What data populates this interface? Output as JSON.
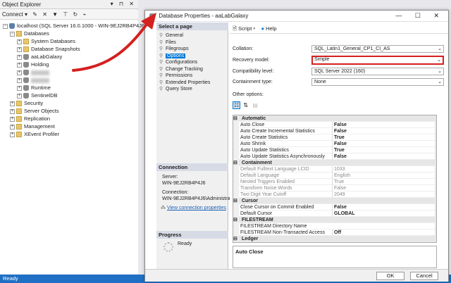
{
  "object_explorer": {
    "title": "Object Explorer",
    "title_controls": "▾ ⊓ ✕",
    "toolbar": [
      "Connect ▾",
      "✎",
      "✕",
      "▼",
      "⊤",
      "↻",
      "⌁"
    ],
    "tree": [
      {
        "label": "localhost (SQL Server 16.0.1000 - WIN-9EJ2RB4P4J6\\Adm",
        "level": 0,
        "exp": "−",
        "icon": "server-icon"
      },
      {
        "label": "Databases",
        "level": 1,
        "exp": "−",
        "icon": "folder-icon"
      },
      {
        "label": "System Databases",
        "level": 2,
        "exp": "+",
        "icon": "folder-icon"
      },
      {
        "label": "Database Snapshots",
        "level": 2,
        "exp": "+",
        "icon": "folder-icon"
      },
      {
        "label": "aaLabGalaxy",
        "level": 2,
        "exp": "+",
        "icon": "database-icon"
      },
      {
        "label": "Holding",
        "level": 2,
        "exp": "+",
        "icon": "database-icon"
      },
      {
        "label": "",
        "level": 2,
        "exp": "+",
        "icon": "database-icon",
        "blurred": true
      },
      {
        "label": "",
        "level": 2,
        "exp": "+",
        "icon": "database-icon",
        "blurred": true
      },
      {
        "label": "Runtime",
        "level": 2,
        "exp": "+",
        "icon": "database-icon"
      },
      {
        "label": "SentinelDB",
        "level": 2,
        "exp": "+",
        "icon": "database-icon"
      },
      {
        "label": "Security",
        "level": 1,
        "exp": "+",
        "icon": "folder-icon"
      },
      {
        "label": "Server Objects",
        "level": 1,
        "exp": "+",
        "icon": "folder-icon"
      },
      {
        "label": "Replication",
        "level": 1,
        "exp": "+",
        "icon": "folder-icon"
      },
      {
        "label": "Management",
        "level": 1,
        "exp": "+",
        "icon": "folder-icon"
      },
      {
        "label": "XEvent Profiler",
        "level": 1,
        "exp": "+",
        "icon": "folder-icon"
      }
    ]
  },
  "status_bar": {
    "text": "Ready"
  },
  "dialog": {
    "title": "Database Properties - aaLabGalaxy",
    "window_controls": "— ☐ ✕",
    "select_page_header": "Select a page",
    "pages": [
      "General",
      "Files",
      "Filegroups",
      "Options",
      "Configurations",
      "Change Tracking",
      "Permissions",
      "Extended Properties",
      "Query Store"
    ],
    "selected_page_index": 3,
    "connection_header": "Connection",
    "server_label": "Server:",
    "server_value": "WIN-9EJ2RB4P4J6",
    "connection_label": "Connection:",
    "connection_value": "WIN-9EJ2RB4P4J6\\Administrator",
    "view_connection_link": "View connection properties",
    "progress_header": "Progress",
    "progress_status": "Ready",
    "script_label": "Script",
    "help_label": "Help",
    "fields": [
      {
        "label": "Collation:",
        "value": "SQL_Latin1_General_CP1_CI_AS"
      },
      {
        "label": "Recovery model:",
        "value": "Simple",
        "highlighted": true
      },
      {
        "label": "Compatibility level:",
        "value": "SQL Server 2022 (160)"
      },
      {
        "label": "Containment type:",
        "value": "None"
      }
    ],
    "other_options_label": "Other options:",
    "options_grid": [
      {
        "type": "cat",
        "name": "Automatic"
      },
      {
        "name": "Auto Close",
        "value": "False",
        "bold": true
      },
      {
        "name": "Auto Create Incremental Statistics",
        "value": "False",
        "bold": true
      },
      {
        "name": "Auto Create Statistics",
        "value": "True",
        "bold": true
      },
      {
        "name": "Auto Shrink",
        "value": "False",
        "bold": true
      },
      {
        "name": "Auto Update Statistics",
        "value": "True",
        "bold": true
      },
      {
        "name": "Auto Update Statistics Asynchronously",
        "value": "False",
        "bold": true
      },
      {
        "type": "cat",
        "name": "Containment"
      },
      {
        "name": "Default Fulltext Language LCID",
        "value": "1033",
        "disabled": true
      },
      {
        "name": "Default Language",
        "value": "English",
        "disabled": true
      },
      {
        "name": "Nested Triggers Enabled",
        "value": "True",
        "disabled": true
      },
      {
        "name": "Transform Noise Words",
        "value": "False",
        "disabled": true
      },
      {
        "name": "Two Digit Year Cutoff",
        "value": "2049",
        "disabled": true
      },
      {
        "type": "cat",
        "name": "Cursor"
      },
      {
        "name": "Close Cursor on Commit Enabled",
        "value": "False",
        "bold": true
      },
      {
        "name": "Default Cursor",
        "value": "GLOBAL",
        "bold": true
      },
      {
        "type": "cat",
        "name": "FILESTREAM"
      },
      {
        "name": "FILESTREAM Directory Name",
        "value": ""
      },
      {
        "name": "FILESTREAM Non-Transacted Access",
        "value": "Off",
        "bold": true
      },
      {
        "type": "cat",
        "name": "Ledger"
      }
    ],
    "description": "Auto Close",
    "ok_label": "OK",
    "cancel_label": "Cancel"
  },
  "colors": {
    "accent": "#0078d7",
    "highlight_box": "#d4201f",
    "arrow": "#d4201f",
    "status_bar": "#1f6fc5"
  }
}
